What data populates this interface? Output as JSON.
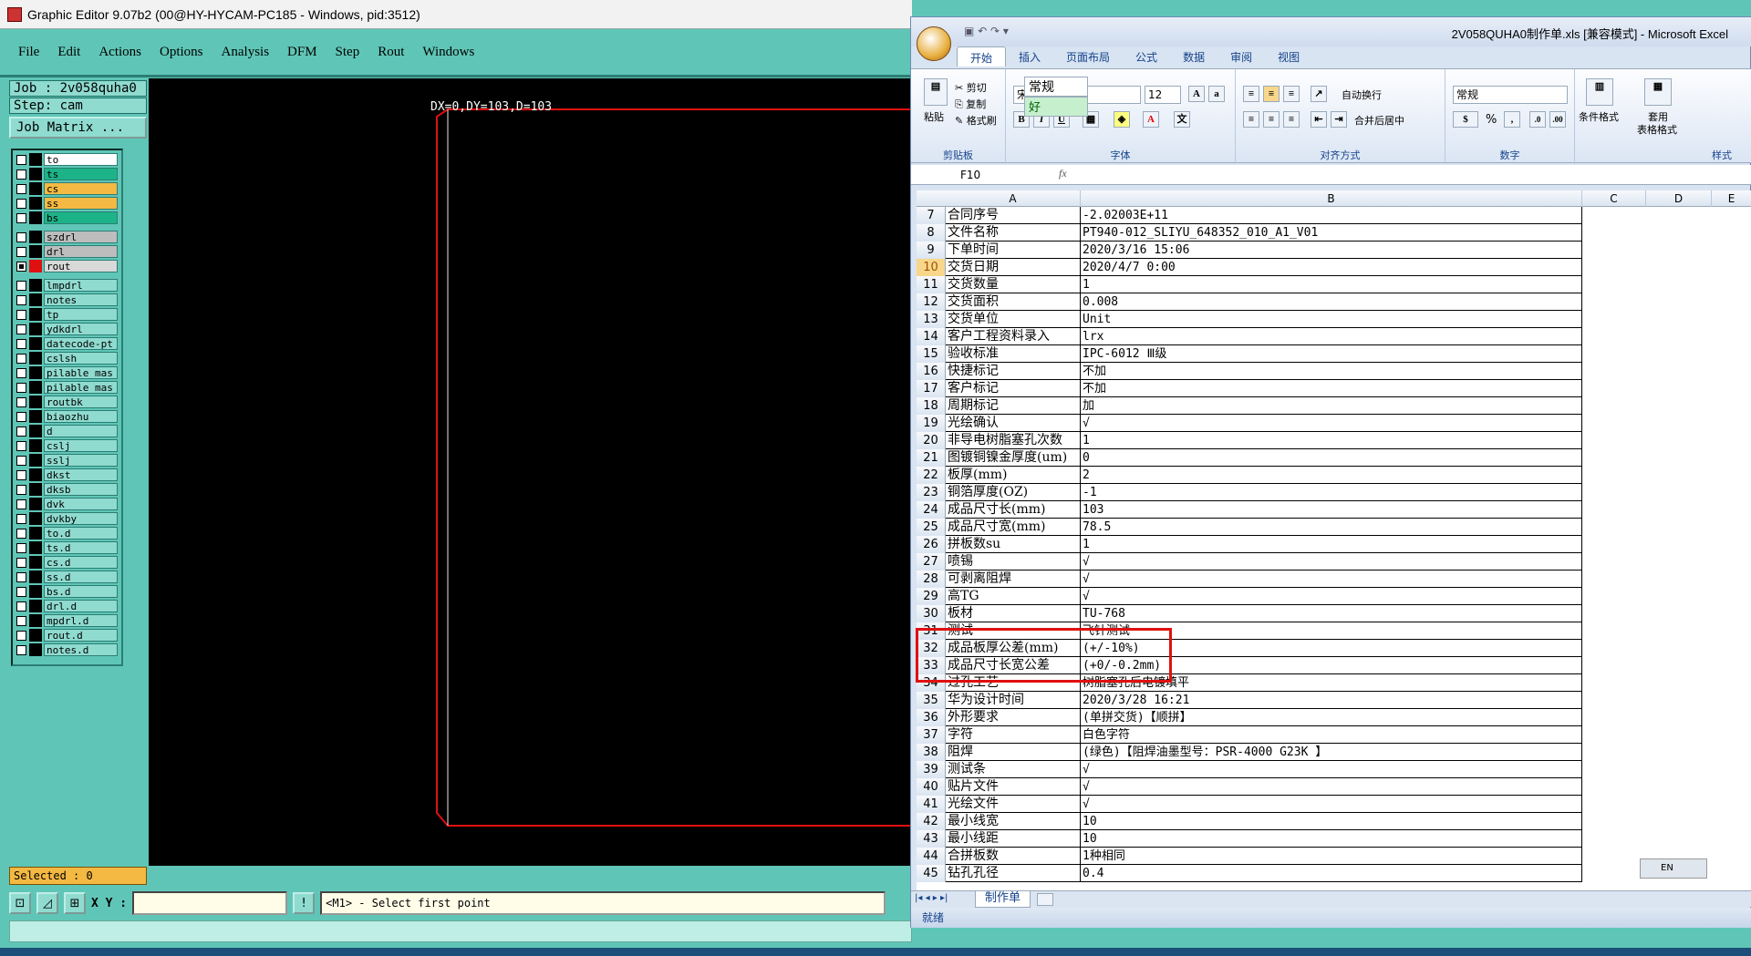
{
  "ge": {
    "title": "Graphic Editor 9.07b2 (00@HY-HYCAM-PC185 - Windows, pid:3512)",
    "menu": [
      "File",
      "Edit",
      "Actions",
      "Options",
      "Analysis",
      "DFM",
      "Step",
      "Rout",
      "Windows"
    ],
    "job_label": "Job : 2v058quha0",
    "step_label": "Step: cam",
    "job_matrix": "Job Matrix ...",
    "layer_groups": [
      [
        {
          "name": "to",
          "color": "#ffffff"
        },
        {
          "name": "ts",
          "color": "#1db388"
        },
        {
          "name": "cs",
          "color": "#f4b942"
        },
        {
          "name": "ss",
          "color": "#f4b942"
        },
        {
          "name": "bs",
          "color": "#1db388"
        }
      ],
      [
        {
          "name": "szdrl",
          "color": "#bdbdbd"
        },
        {
          "name": "drl",
          "color": "#bdbdbd"
        },
        {
          "name": "rout",
          "color": "#d9d9d9",
          "active": true
        }
      ],
      [
        {
          "name": "lmpdrl",
          "color": "#8fdbcf"
        },
        {
          "name": "notes",
          "color": "#8fdbcf"
        },
        {
          "name": "tp",
          "color": "#8fdbcf"
        },
        {
          "name": "ydkdrl",
          "color": "#8fdbcf"
        },
        {
          "name": "datecode-pt",
          "color": "#8fdbcf"
        },
        {
          "name": "cslsh",
          "color": "#8fdbcf"
        },
        {
          "name": "pilable_mas",
          "color": "#8fdbcf"
        },
        {
          "name": "pilable_mas",
          "color": "#8fdbcf"
        },
        {
          "name": "routbk",
          "color": "#8fdbcf"
        },
        {
          "name": "biaozhu",
          "color": "#8fdbcf"
        },
        {
          "name": "d",
          "color": "#8fdbcf"
        },
        {
          "name": "cslj",
          "color": "#8fdbcf"
        },
        {
          "name": "sslj",
          "color": "#8fdbcf"
        },
        {
          "name": "dkst",
          "color": "#8fdbcf"
        },
        {
          "name": "dksb",
          "color": "#8fdbcf"
        },
        {
          "name": "dvk",
          "color": "#8fdbcf"
        },
        {
          "name": "dvkby",
          "color": "#8fdbcf"
        },
        {
          "name": "to.d",
          "color": "#8fdbcf"
        },
        {
          "name": "ts.d",
          "color": "#8fdbcf"
        },
        {
          "name": "cs.d",
          "color": "#8fdbcf"
        },
        {
          "name": "ss.d",
          "color": "#8fdbcf"
        },
        {
          "name": "bs.d",
          "color": "#8fdbcf"
        },
        {
          "name": "drl.d",
          "color": "#8fdbcf"
        },
        {
          "name": "mpdrl.d",
          "color": "#8fdbcf"
        },
        {
          "name": "rout.d",
          "color": "#8fdbcf"
        },
        {
          "name": "notes.d",
          "color": "#8fdbcf"
        }
      ]
    ],
    "measure_readout": "DX=0,DY=103,D=103",
    "selected": "Selected : 0",
    "xy_label": "X Y :",
    "xy_value": "",
    "prompt": "<M1> - Select first point",
    "outline_color": "#e01010"
  },
  "xl": {
    "title": "2V058QUHA0制作单.xls [兼容模式] - Microsoft Excel",
    "tabs": [
      "开始",
      "插入",
      "页面布局",
      "公式",
      "数据",
      "审阅",
      "视图"
    ],
    "clipboard": {
      "paste": "粘贴",
      "cut": "剪切",
      "copy": "复制",
      "format_painter": "格式刷",
      "group": "剪贴板"
    },
    "font": {
      "name": "宋体",
      "size": "12",
      "group": "字体",
      "bold": "B",
      "italic": "I",
      "underline": "U"
    },
    "align": {
      "wrap": "自动换行",
      "merge": "合并后居中",
      "group": "对齐方式"
    },
    "number": {
      "format": "常规",
      "percent": "%",
      "group": "数字"
    },
    "styles": {
      "cond": "条件格式",
      "table1": "套用",
      "table2": "表格格式",
      "normal": "常规",
      "good": "好",
      "group": "样式"
    },
    "namebox": "F10",
    "columns": [
      "A",
      "B",
      "C",
      "D",
      "E"
    ],
    "rows": [
      {
        "n": "7",
        "a": "合同序号",
        "b": "-2.02003E+11"
      },
      {
        "n": "8",
        "a": "文件名称",
        "b": "PT940-012_SLIYU_648352_010_A1_V01"
      },
      {
        "n": "9",
        "a": "下单时间",
        "b": "2020/3/16 15:06"
      },
      {
        "n": "10",
        "a": "交货日期",
        "b": "2020/4/7 0:00",
        "sel": true
      },
      {
        "n": "11",
        "a": "交货数量",
        "b": "1"
      },
      {
        "n": "12",
        "a": "交货面积",
        "b": "0.008"
      },
      {
        "n": "13",
        "a": "交货单位",
        "b": "Unit"
      },
      {
        "n": "14",
        "a": "客户工程资料录入",
        "b": "lrx"
      },
      {
        "n": "15",
        "a": "验收标准",
        "b": "IPC-6012 Ⅲ级"
      },
      {
        "n": "16",
        "a": "快捷标记",
        "b": "不加"
      },
      {
        "n": "17",
        "a": "客户标记",
        "b": "不加"
      },
      {
        "n": "18",
        "a": "周期标记",
        "b": "加"
      },
      {
        "n": "19",
        "a": "光绘确认",
        "b": "√"
      },
      {
        "n": "20",
        "a": "非导电树脂塞孔次数",
        "b": "1"
      },
      {
        "n": "21",
        "a": "图镀铜镍金厚度(um)",
        "b": "0"
      },
      {
        "n": "22",
        "a": "板厚(mm)",
        "b": "2"
      },
      {
        "n": "23",
        "a": "铜箔厚度(OZ)",
        "b": "-1"
      },
      {
        "n": "24",
        "a": "成品尺寸长(mm)",
        "b": "103"
      },
      {
        "n": "25",
        "a": "成品尺寸宽(mm)",
        "b": "78.5"
      },
      {
        "n": "26",
        "a": "拼板数su",
        "b": "1"
      },
      {
        "n": "27",
        "a": "喷锡",
        "b": "√"
      },
      {
        "n": "28",
        "a": "可剥离阻焊",
        "b": "√"
      },
      {
        "n": "29",
        "a": "高TG",
        "b": "√"
      },
      {
        "n": "30",
        "a": "板材",
        "b": "TU-768"
      },
      {
        "n": "31",
        "a": "测试",
        "b": "飞针测试"
      },
      {
        "n": "32",
        "a": "成品板厚公差(mm)",
        "b": "(+/-10%)"
      },
      {
        "n": "33",
        "a": "成品尺寸长宽公差",
        "b": "(+0/-0.2mm)"
      },
      {
        "n": "34",
        "a": "过孔工艺",
        "b": "树脂塞孔后电镀填平"
      },
      {
        "n": "35",
        "a": "华为设计时间",
        "b": "2020/3/28 16:21"
      },
      {
        "n": "36",
        "a": "外形要求",
        "b": "(单拼交货)【顺拼】"
      },
      {
        "n": "37",
        "a": "字符",
        "b": "白色字符"
      },
      {
        "n": "38",
        "a": "阻焊",
        "b": "(绿色)【阻焊油墨型号：PSR-4000 G23K 】"
      },
      {
        "n": "39",
        "a": "测试条",
        "b": "√"
      },
      {
        "n": "40",
        "a": "贴片文件",
        "b": "√"
      },
      {
        "n": "41",
        "a": "光绘文件",
        "b": "√"
      },
      {
        "n": "42",
        "a": "最小线宽",
        "b": "10"
      },
      {
        "n": "43",
        "a": "最小线距",
        "b": "10"
      },
      {
        "n": "44",
        "a": "合拼板数",
        "b": "1种相同"
      },
      {
        "n": "45",
        "a": "钻孔孔径",
        "b": "0.4"
      }
    ],
    "sheet_tab": "制作单",
    "status": "就绪",
    "lang": "EN",
    "highlight_color": "#e01010"
  }
}
